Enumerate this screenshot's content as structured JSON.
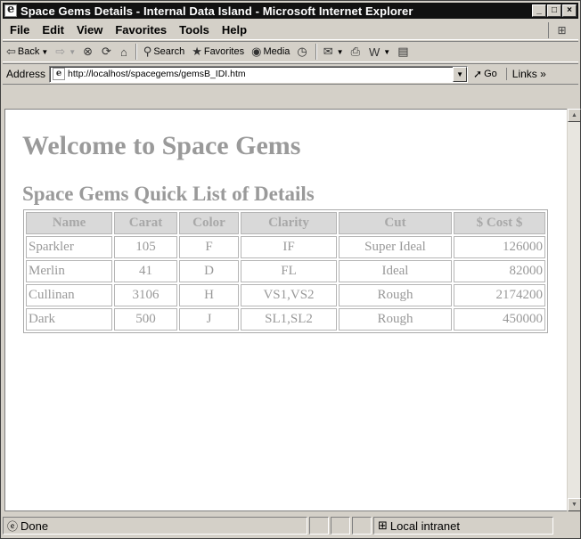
{
  "window": {
    "title": "Space Gems Details - Internal Data Island - Microsoft Internet Explorer",
    "controls": [
      "_",
      "□",
      "×"
    ]
  },
  "menu": [
    "File",
    "Edit",
    "View",
    "Favorites",
    "Tools",
    "Help"
  ],
  "toolbar": {
    "back": "Back",
    "search": "Search",
    "favorites": "Favorites",
    "media": "Media"
  },
  "address": {
    "label": "Address",
    "url": "http://localhost/spacegems/gemsB_IDI.htm",
    "go": "Go",
    "links": "Links"
  },
  "page": {
    "heading": "Welcome to Space Gems",
    "subheading": "Space Gems Quick List of Details",
    "table": {
      "headers": [
        "Name",
        "Carat",
        "Color",
        "Clarity",
        "Cut",
        "$ Cost $"
      ],
      "rows": [
        [
          "Sparkler",
          "105",
          "F",
          "IF",
          "Super Ideal",
          "126000"
        ],
        [
          "Merlin",
          "41",
          "D",
          "FL",
          "Ideal",
          "82000"
        ],
        [
          "Cullinan",
          "3106",
          "H",
          "VS1,VS2",
          "Rough",
          "2174200"
        ],
        [
          "Dark",
          "500",
          "J",
          "SL1,SL2",
          "Rough",
          "450000"
        ]
      ]
    }
  },
  "status": {
    "text": "Done",
    "zone": "Local intranet"
  }
}
